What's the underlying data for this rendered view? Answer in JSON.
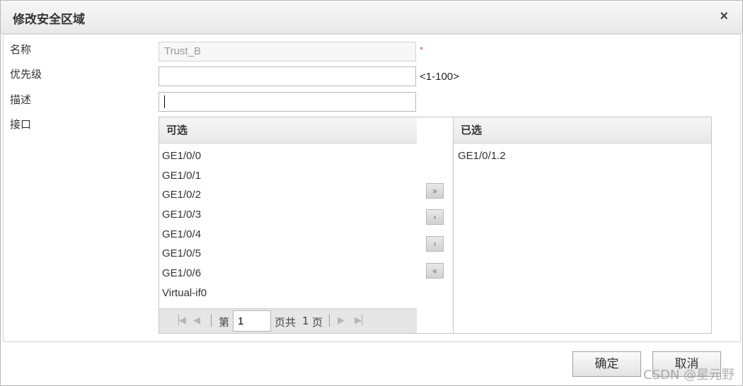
{
  "dialog": {
    "title": "修改安全区域",
    "close_glyph": "×"
  },
  "form": {
    "name_label": "名称",
    "name_value": "Trust_B",
    "required_mark": "*",
    "priority_label": "优先级",
    "priority_value": "",
    "priority_hint": "<1-100>",
    "description_label": "描述",
    "description_value": "",
    "interface_label": "接口"
  },
  "available": {
    "header": "可选",
    "items": [
      "GE1/0/0",
      "GE1/0/1",
      "GE1/0/2",
      "GE1/0/3",
      "GE1/0/4",
      "GE1/0/5",
      "GE1/0/6",
      "Virtual-if0"
    ],
    "pager": {
      "prefix": "第",
      "page": "1",
      "middle": "页共",
      "total": "1",
      "suffix": "页"
    }
  },
  "selected": {
    "header": "已选",
    "items": [
      "GE1/0/1.2"
    ]
  },
  "move_buttons": {
    "add_all": "»",
    "add": "›",
    "remove": "‹",
    "remove_all": "«"
  },
  "footer": {
    "ok_label": "确定",
    "cancel_label": "取消"
  },
  "watermark": "CSDN @星元野"
}
